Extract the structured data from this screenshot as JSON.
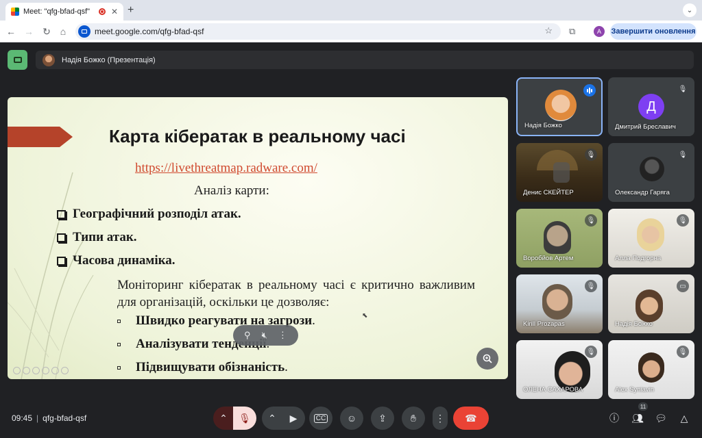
{
  "browser": {
    "tab_title": "Meet: \"qfg-bfad-qsf\"",
    "url": "meet.google.com/qfg-bfad-qsf",
    "profile_initial": "A",
    "update_button": "Завершити оновлення"
  },
  "meet": {
    "presenter_label": "Надія Божко (Презентація)",
    "time": "09:45",
    "meeting_code": "qfg-bfad-qsf",
    "participants_count": "11"
  },
  "slide": {
    "title": "Карта кібератак в реальному часі",
    "link": "https://livethreatmap.radware.com/",
    "subtitle": "Аналіз карти:",
    "bullets": [
      "Географічний розподіл атак.",
      "Типи атак.",
      "Часова динаміка."
    ],
    "paragraph": "Моніторинг кібератак в реальному часі є критично важливим для організацій, оскільки це дозволяє:",
    "sub_bullets": [
      {
        "bold": "Швидко реагувати на загрози",
        "rest": "."
      },
      {
        "bold": "Аналізувати тенденції",
        "rest": "."
      },
      {
        "bold": "Підвищувати обізнаність",
        "rest": "."
      }
    ]
  },
  "participants": [
    {
      "name": "Надія Божко",
      "status": "speaking"
    },
    {
      "name": "Дмитрий Бреславич",
      "initial": "Д",
      "status": "muted"
    },
    {
      "name": "Денис СКЕЙТЕР",
      "status": "muted"
    },
    {
      "name": "Олександр Гаряга",
      "status": "muted"
    },
    {
      "name": "Воробйов Артем",
      "status": "muted"
    },
    {
      "name": "Алла Подгорна",
      "status": "muted"
    },
    {
      "name": "Kirill Prozapas",
      "status": "muted"
    },
    {
      "name": "Надія Божко",
      "status": "presenting"
    },
    {
      "name": "ОЛЕНА САХАРОВА",
      "status": "muted"
    },
    {
      "name": "Alex Syniavin",
      "status": "muted"
    }
  ]
}
